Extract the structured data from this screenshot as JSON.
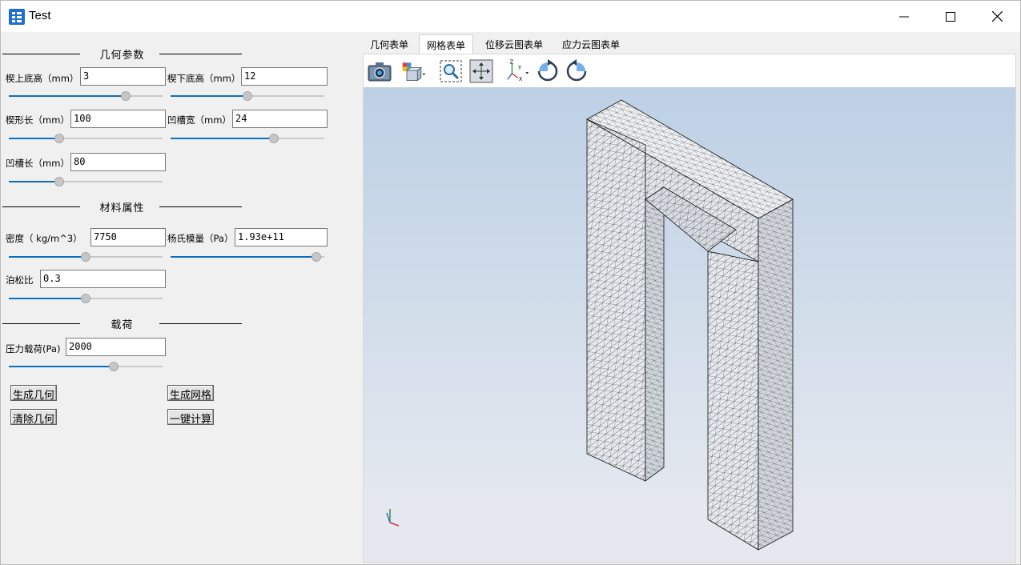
{
  "window": {
    "title": "Test"
  },
  "sections": {
    "geometry": "几何参数",
    "material": "材料属性",
    "load": "载荷"
  },
  "params": {
    "wedge_top_height": {
      "label": "楔上底高（mm）",
      "value": "3",
      "slider": 0.76
    },
    "wedge_bottom_height": {
      "label": "楔下底高（mm）",
      "value": "12",
      "slider": 0.5
    },
    "wedge_length": {
      "label": "楔形长（mm）",
      "value": "100",
      "slider": 0.33
    },
    "groove_width": {
      "label": "凹槽宽（mm）",
      "value": "24",
      "slider": 0.67
    },
    "groove_length": {
      "label": "凹槽长（mm）",
      "value": "80",
      "slider": 0.33
    },
    "density": {
      "label": "密度（ kg/m^3）",
      "value": "7750",
      "slider": 0.5
    },
    "youngs_modulus": {
      "label": "杨氏模量（Pa）",
      "value": "1.93e+11",
      "slider": 0.95
    },
    "poisson_ratio": {
      "label": "泊松比",
      "value": "0.3",
      "slider": 0.5
    },
    "pressure_load": {
      "label": "压力载荷(Pa)",
      "value": "2000",
      "slider": 0.68
    }
  },
  "buttons": {
    "generate_geometry": "生成几何",
    "generate_mesh": "生成网格",
    "clear_geometry": "清除几何",
    "one_click_compute": "一键计算"
  },
  "tabs": [
    {
      "label": "几何表单",
      "active": false
    },
    {
      "label": "网格表单",
      "active": true
    },
    {
      "label": "位移云图表单",
      "active": false
    },
    {
      "label": "应力云图表单",
      "active": false
    }
  ],
  "toolbar": {
    "icons": [
      "camera-icon",
      "view-box-icon",
      "zoom-box-icon",
      "fit-view-icon",
      "axes-view-icon",
      "rotate-cw-icon",
      "rotate-ccw-icon"
    ]
  },
  "colors": {
    "accent": "#0a6fbf",
    "viewport_top": "#bdd0e5",
    "viewport_bottom": "#e5e9ef"
  }
}
